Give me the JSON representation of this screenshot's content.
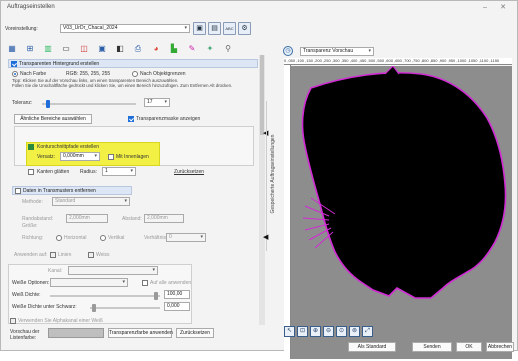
{
  "window": {
    "title": "Auftragseinstellen"
  },
  "toolbar": {
    "preset_label": "Voreinstellung:",
    "preset_value": "V03_UrDr_Chacal_2024",
    "save_icon": "save-icon",
    "save_as_icon": "save-as-icon",
    "abc_label": "ABC",
    "settings_icon": "settings-icon"
  },
  "tool_icons": [
    "layout-icon",
    "crop-icon",
    "grid-icon",
    "monitor-icon",
    "border-icon",
    "frame-icon",
    "layers-icon",
    "print-icon",
    "color-icon",
    "chart-icon",
    "brush-icon",
    "wand-icon",
    "pin-icon"
  ],
  "transparency": {
    "header": "Transparenten Hintergrund erstellen",
    "by_color": "Nach Farbe",
    "rgb_value": "RGB: 255, 255, 255",
    "by_object": "Nach Objektgrenzen",
    "tip": "Tipp: Klicken Sie auf der Vorschau links, um einen transparenten Bereich auszuwählen.",
    "tip2": "Füllen Sie die Unschaltfläche gedrückt und klicken Sie, um einen Bereich hinzuzufügen. Zum Entfernen Alt drücken.",
    "tolerance_label": "Toleranz:",
    "tolerance_value": "17",
    "select_similar": "Ähnliche Bereiche auswählen",
    "show_transparency": "Transparenzmaske anzeigen"
  },
  "contour": {
    "create_label": "Konturschnittpfade erstellen",
    "offset_label": "Versatz:",
    "offset_value": "0,000mm",
    "with_gaps": "Mit Innenlagen",
    "smooth_label": "Kanten glätten",
    "radius_label": "Radius:",
    "radius_value": "1",
    "reset_link": "Zurücksetzen"
  },
  "cut_marks": {
    "header": "Daten in Transmusters entfernen",
    "method_label": "Methode:",
    "method_value": "Standard",
    "border_label": "Randabstand:",
    "border_value": "2,000mm",
    "spacing_label": "Abstand:",
    "spacing_value": "2,000mm",
    "size_label": "Größe:",
    "direction_label": "Richtung:",
    "horizontal": "Horizontal",
    "vertical": "Vertikal",
    "angle_label": "Verhältnis:",
    "angle_value": "0",
    "apply_label": "Anwenden auf:",
    "left_opt": "Linien",
    "right_opt": "Weiss"
  },
  "white": {
    "header": "Kanal:",
    "white_options_label": "Weiße Optionen:",
    "apply_all": "Auf alle anwenden",
    "white_density_label": "Weiß Dichte:",
    "white_density_value": "100,00",
    "under_black_label": "Weiße Dichte unter Schwarz:",
    "under_black_value": "0,000",
    "use_alpha": "Verwenden Sie Alphakanal einer Weiß"
  },
  "bottom_left": {
    "preview_label": "Vorschau der Listenfarbe:",
    "apply_button": "Transparenzfarbe anwenden",
    "reset_button": "Zurücksetzen"
  },
  "side_tab": {
    "label": "Gespeicherte Auftragseinstellungen"
  },
  "preview": {
    "mode_value": "Transparenz Vorschau",
    "ruler_ticks": "0 ,050 ,100 ,150 ,200 ,250 ,300 ,350 ,400 ,450 ,500 ,550 ,600 ,650 ,700 ,750 ,800 ,850 ,900 ,950 ,1000 ,1050 ,1100 ,1150"
  },
  "zoom_tools": [
    "pointer-icon",
    "zoom-fit-icon",
    "zoom-in-icon",
    "zoom-out-icon",
    "zoom-selection-icon",
    "zoom-page-icon",
    "expand-icon"
  ],
  "footer": {
    "default_button": "Als Standard",
    "send_button": "Senden",
    "ok_button": "OK",
    "cancel_button": "Abbrechen"
  },
  "colors": {
    "accent": "#1e6fd9",
    "highlight": "#f2f044",
    "canvas_bg": "#8d8d8d",
    "silhouette": "#000000",
    "contour": "#d22bd6"
  }
}
